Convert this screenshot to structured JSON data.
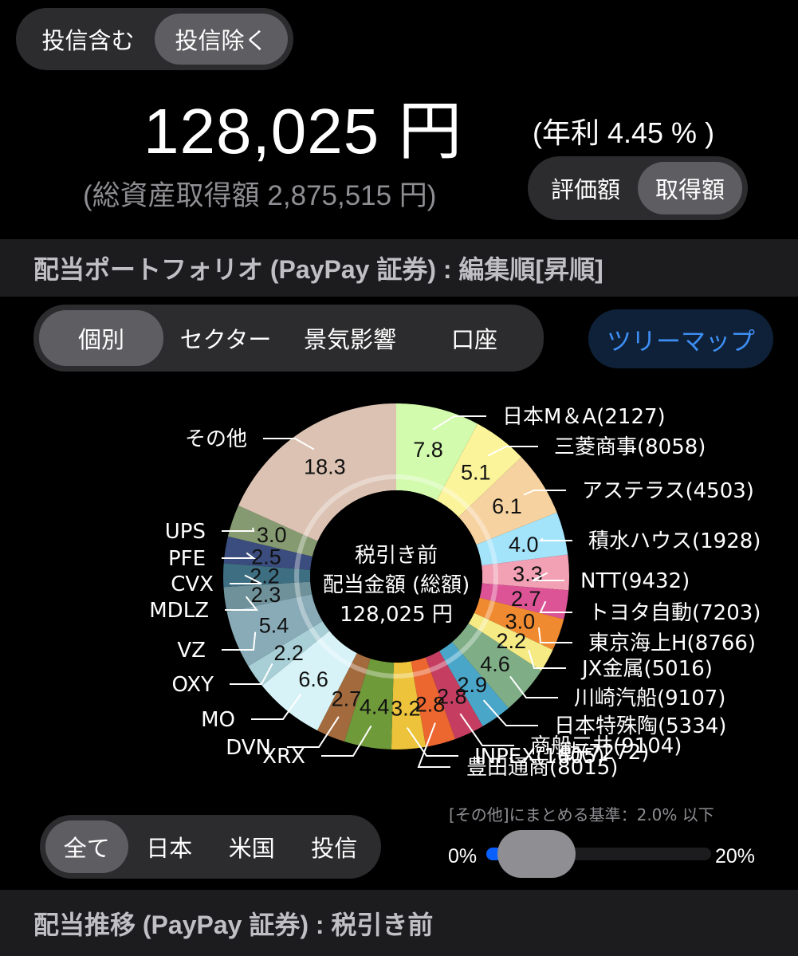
{
  "incl_toggle": {
    "options": [
      "投信含む",
      "投信除く"
    ],
    "selected": "投信除く"
  },
  "summary": {
    "amount": "128,025 円",
    "yield": "(年利 4.45 % )",
    "total_cost": "(総資産取得額 2,875,515 円)"
  },
  "basis_toggle": {
    "options": [
      "評価額",
      "取得額"
    ],
    "selected": "取得額"
  },
  "portfolio_header": "配当ポートフォリオ (PayPay 証券) : 編集順[昇順]",
  "view_toggle": {
    "options": [
      "個別",
      "セクター",
      "景気影響",
      "口座"
    ],
    "selected": "個別"
  },
  "treemap_button": "ツリーマップ",
  "donut_center": {
    "line1": "税引き前",
    "line2": "配当金額 (総額)",
    "line3": "128,025 円"
  },
  "chart_data": {
    "type": "pie",
    "style": "donut",
    "order": "clockwise from top",
    "slices": [
      {
        "label": "日本M＆A(2127)",
        "value": 7.8,
        "color": "#d2fbad"
      },
      {
        "label": "三菱商事(8058)",
        "value": 5.1,
        "color": "#fbf49a"
      },
      {
        "label": "アステラス(4503)",
        "value": 6.1,
        "color": "#f6d2a0"
      },
      {
        "label": "積水ハウス(1928)",
        "value": 4.0,
        "color": "#a4e4fb"
      },
      {
        "label": "NTT(9432)",
        "value": 3.3,
        "color": "#f2a0b4"
      },
      {
        "label": "トヨタ自動(7203)",
        "value": 2.7,
        "color": "#dd5496"
      },
      {
        "label": "東京海上H(8766)",
        "value": 3.0,
        "color": "#f08a30"
      },
      {
        "label": "JX金属(5016)",
        "value": 2.2,
        "color": "#f6ea84"
      },
      {
        "label": "川崎汽船(9107)",
        "value": 4.6,
        "color": "#7fae86"
      },
      {
        "label": "日本特殊陶(5334)",
        "value": 2.9,
        "color": "#4aa6c9"
      },
      {
        "label": "商船三井(9104)",
        "value": 2.8,
        "color": "#c53e62"
      },
      {
        "label": "豊田通商(8015)",
        "value": 2.8,
        "color": "#ec6630"
      },
      {
        "label": "INPEX(1605)",
        "value": 3.2,
        "color": "#ecc33a"
      },
      {
        "label": "XRX",
        "value": 4.4,
        "color": "#6f9a3a"
      },
      {
        "label": "DVN",
        "value": 2.7,
        "color": "#a36a3e"
      },
      {
        "label": "MO",
        "value": 6.6,
        "color": "#d7f3f7"
      },
      {
        "label": "OXY",
        "value": 2.2,
        "color": "#a8cfd6"
      },
      {
        "label": "VZ",
        "value": 5.4,
        "color": "#88abb7"
      },
      {
        "label": "MDLZ",
        "value": 2.3,
        "color": "#6f929a"
      },
      {
        "label": "CVX",
        "value": 2.2,
        "color": "#3d6e82"
      },
      {
        "label": "PFE",
        "value": 2.5,
        "color": "#3b4c7e"
      },
      {
        "label": "UPS",
        "value": 3.0,
        "color": "#869a72"
      },
      {
        "label": "その他",
        "value": 18.3,
        "color": "#dcc2b3"
      }
    ],
    "obscured_label_text": "動(7272)"
  },
  "region_toggle": {
    "options": [
      "全て",
      "日本",
      "米国",
      "投信"
    ],
    "selected": "全て"
  },
  "threshold": {
    "label": "[その他]にまとめる基準：2.0% 以下",
    "min": "0%",
    "max": "20%",
    "value_percent": 2.0
  },
  "trend_header": "配当推移 (PayPay 証券) : 税引き前"
}
